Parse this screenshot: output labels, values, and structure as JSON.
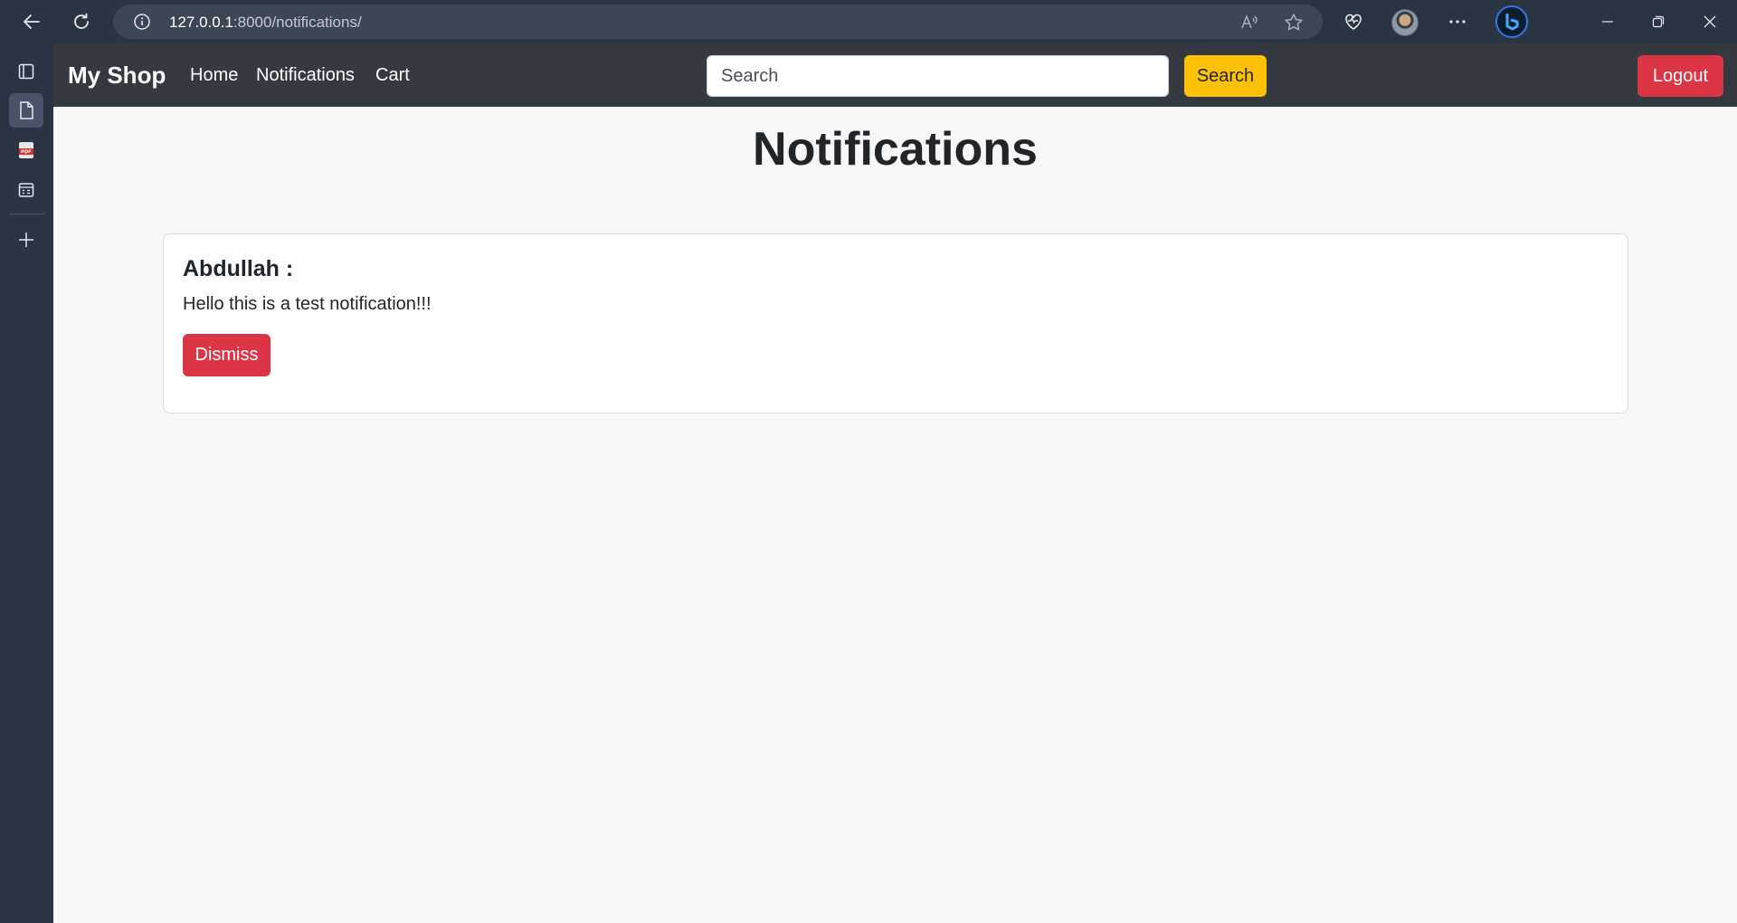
{
  "browser": {
    "url_host": "127.0.0.1",
    "url_rest": ":8000/notifications/"
  },
  "navbar": {
    "brand": "My Shop",
    "links": [
      {
        "label": "Home"
      },
      {
        "label": "Notifications"
      },
      {
        "label": "Cart"
      }
    ],
    "search": {
      "placeholder": "Search",
      "value": ""
    },
    "search_button": "Search",
    "logout_button": "Logout"
  },
  "page": {
    "title": "Notifications",
    "notifications": [
      {
        "sender": "Abdullah :",
        "message": "Hello this is a test notification!!!",
        "dismiss_label": "Dismiss"
      }
    ]
  },
  "colors": {
    "navbar_bg": "#343a40",
    "search_button": "#ffc107",
    "danger": "#dc3545",
    "chrome_bg": "#2b3442"
  }
}
